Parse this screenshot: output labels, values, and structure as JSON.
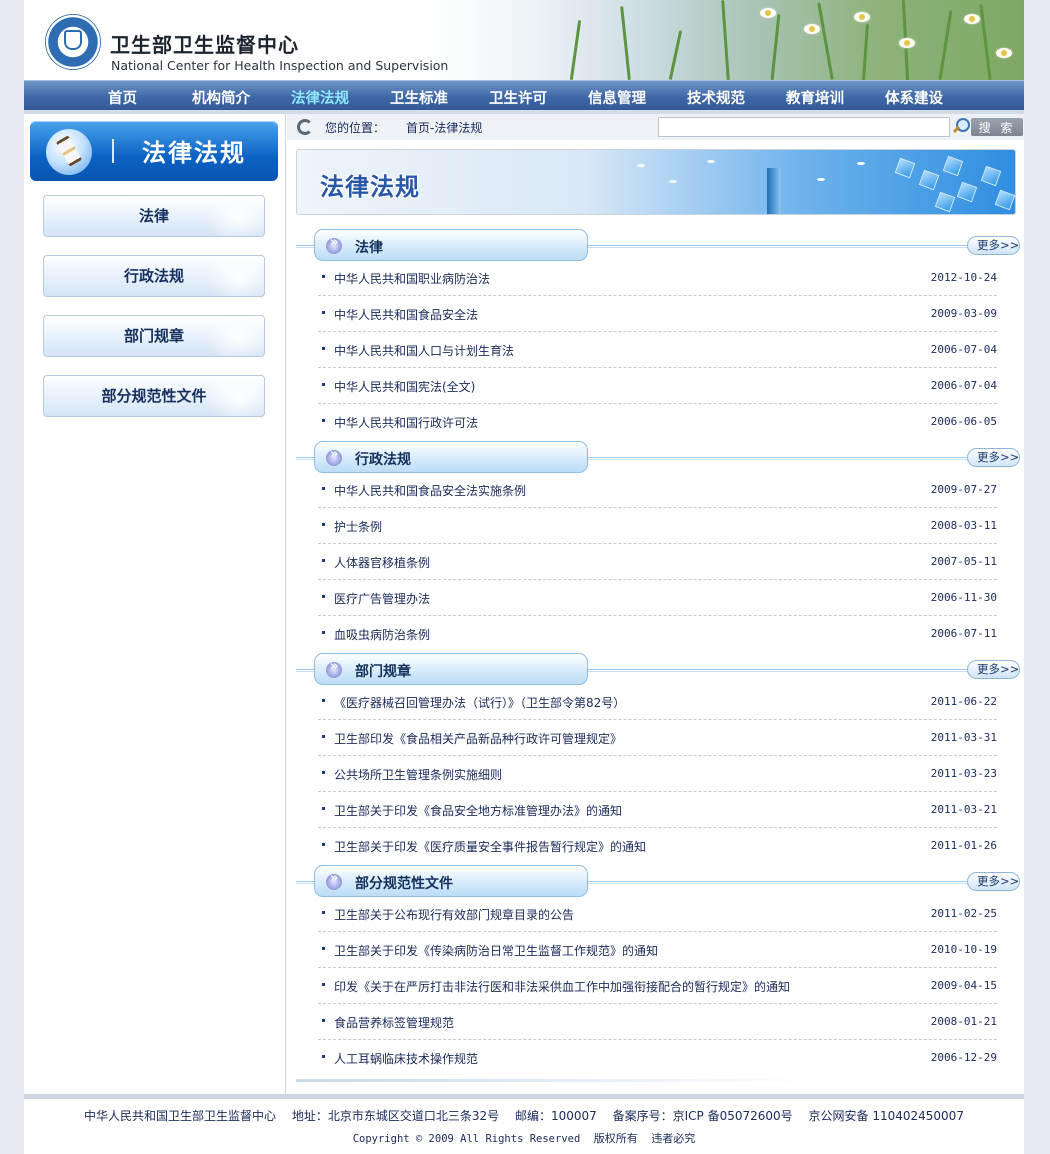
{
  "header": {
    "title": "卫生部卫生监督中心",
    "subtitle": "National Center for Health Inspection and Supervision"
  },
  "nav": {
    "items": [
      "首页",
      "机构简介",
      "法律法规",
      "卫生标准",
      "卫生许可",
      "信息管理",
      "技术规范",
      "教育培训",
      "体系建设"
    ],
    "active_index": 2
  },
  "sidebar": {
    "banner_title": "法律法规",
    "buttons": [
      "法律",
      "行政法规",
      "部门规章",
      "部分规范性文件"
    ]
  },
  "breadcrumb": {
    "label": "您的位置：",
    "path": "首页-法律法规"
  },
  "search": {
    "value": "",
    "button_label": "搜 索"
  },
  "main_banner": {
    "title": "法律法规"
  },
  "sections": [
    {
      "title": "法律",
      "more": "更多>>",
      "items": [
        {
          "title": "中华人民共和国职业病防治法",
          "date": "2012-10-24"
        },
        {
          "title": "中华人民共和国食品安全法",
          "date": "2009-03-09"
        },
        {
          "title": "中华人民共和国人口与计划生育法",
          "date": "2006-07-04"
        },
        {
          "title": "中华人民共和国宪法(全文)",
          "date": "2006-07-04"
        },
        {
          "title": "中华人民共和国行政许可法",
          "date": "2006-06-05"
        }
      ]
    },
    {
      "title": "行政法规",
      "more": "更多>>",
      "items": [
        {
          "title": "中华人民共和国食品安全法实施条例",
          "date": "2009-07-27"
        },
        {
          "title": "护士条例",
          "date": "2008-03-11"
        },
        {
          "title": "人体器官移植条例",
          "date": "2007-05-11"
        },
        {
          "title": "医疗广告管理办法",
          "date": "2006-11-30"
        },
        {
          "title": "血吸虫病防治条例",
          "date": "2006-07-11"
        }
      ]
    },
    {
      "title": "部门规章",
      "more": "更多>>",
      "items": [
        {
          "title": "《医疗器械召回管理办法（试行）》（卫生部令第82号）",
          "date": "2011-06-22"
        },
        {
          "title": "卫生部印发《食品相关产品新品种行政许可管理规定》",
          "date": "2011-03-31"
        },
        {
          "title": "公共场所卫生管理条例实施细则",
          "date": "2011-03-23"
        },
        {
          "title": "卫生部关于印发《食品安全地方标准管理办法》的通知",
          "date": "2011-03-21"
        },
        {
          "title": "卫生部关于印发《医疗质量安全事件报告暂行规定》的通知",
          "date": "2011-01-26"
        }
      ]
    },
    {
      "title": "部分规范性文件",
      "more": "更多>>",
      "items": [
        {
          "title": "卫生部关于公布现行有效部门规章目录的公告",
          "date": "2011-02-25"
        },
        {
          "title": "卫生部关于印发《传染病防治日常卫生监督工作规范》的通知",
          "date": "2010-10-19"
        },
        {
          "title": "印发《关于在严厉打击非法行医和非法采供血工作中加强衔接配合的暂行规定》的通知",
          "date": "2009-04-15"
        },
        {
          "title": "食品营养标签管理规范",
          "date": "2008-01-21"
        },
        {
          "title": "人工耳蜗临床技术操作规范",
          "date": "2006-12-29"
        }
      ]
    }
  ],
  "footer": {
    "org": "中华人民共和国卫生部卫生监督中心",
    "address": "地址：北京市东城区交道口北三条32号",
    "postcode": "邮编：100007",
    "icp": "备案序号：京ICP 备05072600号",
    "police": "京公网安备 110402450007",
    "copyright": "Copyright © 2009 All Rights Reserved",
    "rights": "版权所有",
    "warning": "违者必究"
  }
}
